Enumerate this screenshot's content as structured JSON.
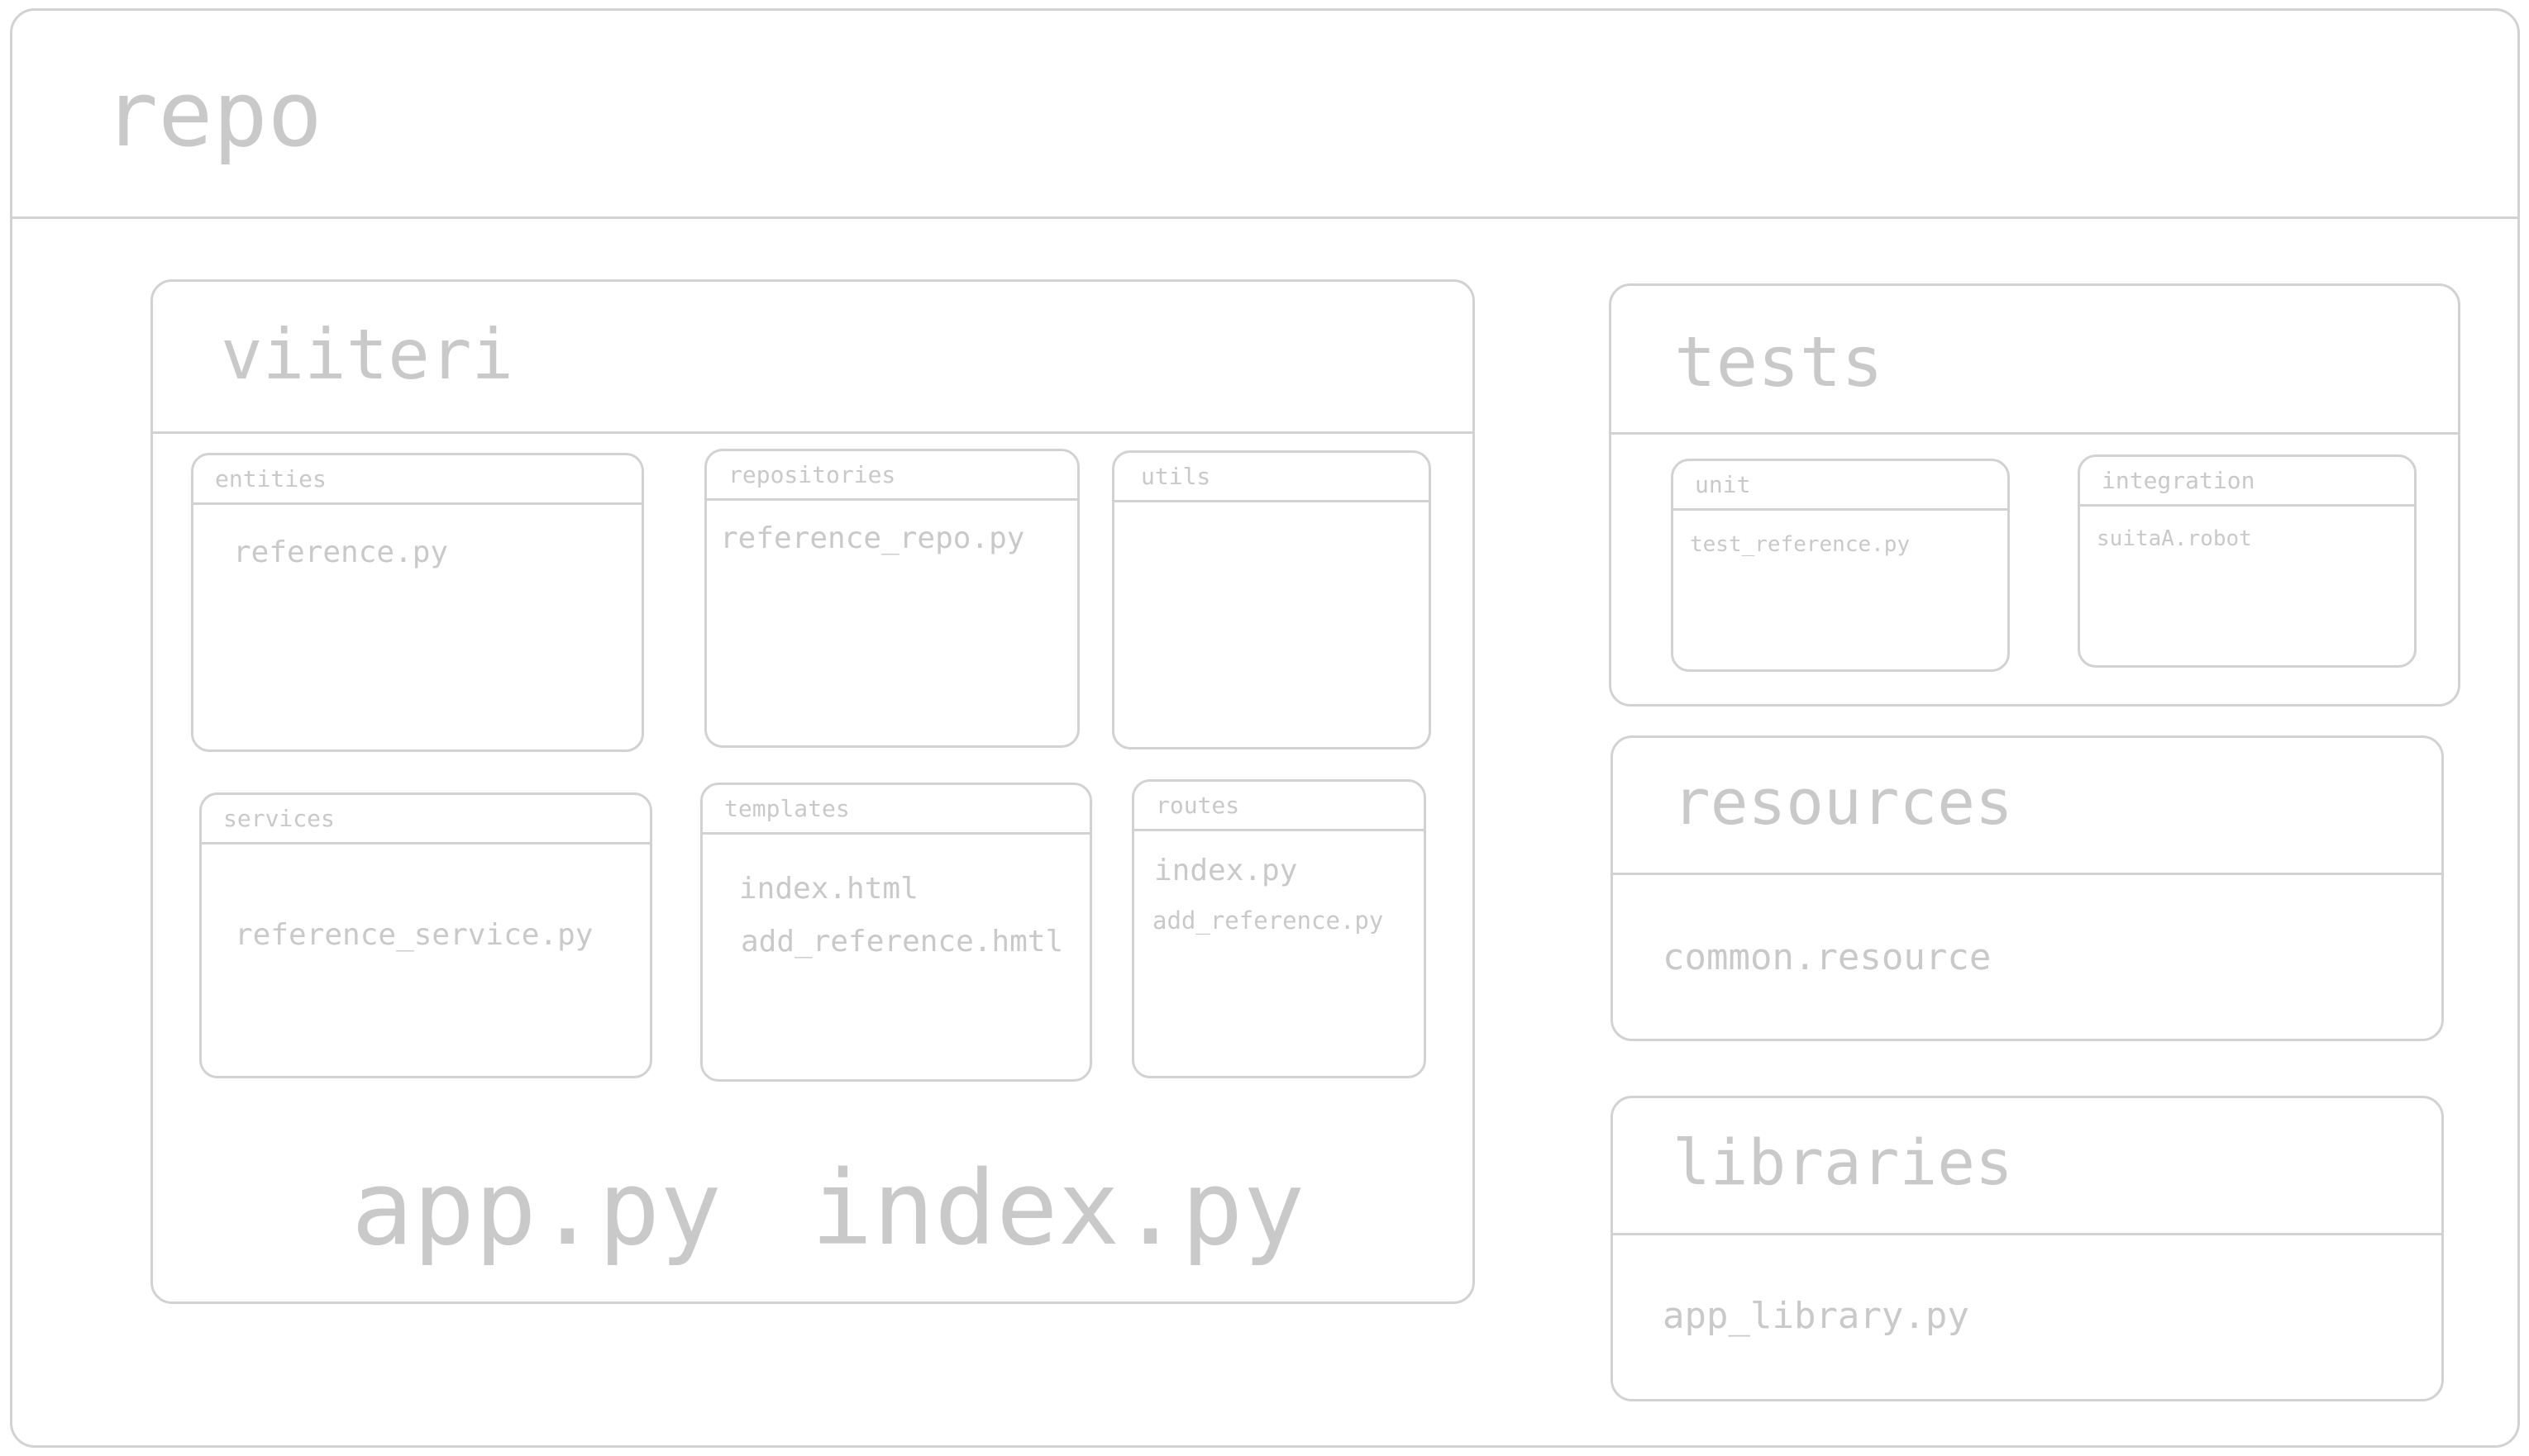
{
  "repo": {
    "title": "repo",
    "viiteri": {
      "title": "viiteri",
      "entities": {
        "title": "entities",
        "files": [
          "reference.py"
        ]
      },
      "repositories": {
        "title": "repositories",
        "files": [
          "reference_repo.py"
        ]
      },
      "utils": {
        "title": "utils",
        "files": []
      },
      "services": {
        "title": "services",
        "files": [
          "reference_service.py"
        ]
      },
      "templates": {
        "title": "templates",
        "files": [
          "index.html",
          "add_reference.hmtl"
        ]
      },
      "routes": {
        "title": "routes",
        "files": [
          "index.py",
          "add_reference.py"
        ]
      },
      "root_files": [
        "app.py",
        "index.py"
      ]
    },
    "tests": {
      "title": "tests",
      "unit": {
        "title": "unit",
        "files": [
          "test_reference.py"
        ]
      },
      "integration": {
        "title": "integration",
        "files": [
          "suitaA.robot"
        ]
      }
    },
    "resources": {
      "title": "resources",
      "files": [
        "common.resource"
      ]
    },
    "libraries": {
      "title": "libraries",
      "files": [
        "app_library.py"
      ]
    }
  }
}
